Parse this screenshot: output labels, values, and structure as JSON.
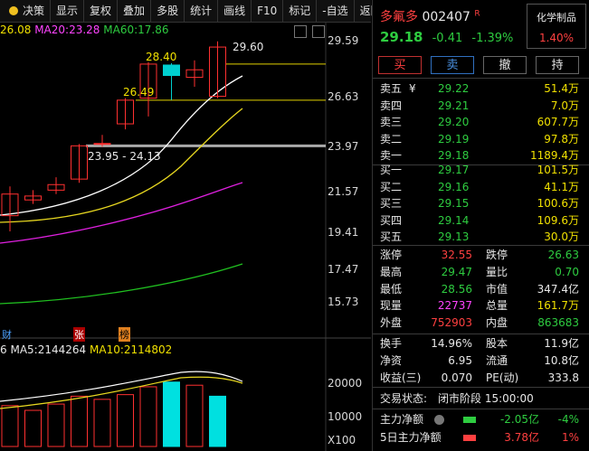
{
  "toolbar": {
    "items": [
      "决策",
      "显示",
      "复权",
      "叠加",
      "多股",
      "统计",
      "画线",
      "F10",
      "标记",
      "-自选",
      "返回"
    ]
  },
  "ma_legend": {
    "ma10": "26.08",
    "ma20_label": "MA20:",
    "ma20": "23.28",
    "ma60_label": "MA60:",
    "ma60": "17.86"
  },
  "y_axis": [
    "29.59",
    "26.63",
    "23.97",
    "21.57",
    "19.41",
    "17.47",
    "15.73"
  ],
  "annotations": {
    "high": "29.60",
    "level1": "28.40",
    "level2": "26.49",
    "range": "23.95 - 24.13"
  },
  "markers": [
    "财",
    "张",
    "榜"
  ],
  "vol_legend": {
    "prefix": "6",
    "ma5_label": "MA5:",
    "ma5": "2144264",
    "ma10_label": "MA10:",
    "ma10": "2114802"
  },
  "vol_axis": [
    "20000",
    "10000"
  ],
  "vol_unit": "X100",
  "stock": {
    "name": "多氟多",
    "code": "002407",
    "tag": "R",
    "sector": "化学制品",
    "sector_change": "1.40%",
    "price": "29.18",
    "change": "-0.41",
    "change_pct": "-1.39%"
  },
  "buttons": {
    "buy": "买",
    "sell": "卖",
    "cancel": "撤",
    "hold": "持"
  },
  "asks": [
    {
      "label": "卖五",
      "price": "29.22",
      "vol": "51.4万"
    },
    {
      "label": "卖四",
      "price": "29.21",
      "vol": "7.0万"
    },
    {
      "label": "卖三",
      "price": "29.20",
      "vol": "607.7万"
    },
    {
      "label": "卖二",
      "price": "29.19",
      "vol": "97.8万"
    },
    {
      "label": "卖一",
      "price": "29.18",
      "vol": "1189.4万"
    }
  ],
  "ask_symbol": "¥",
  "bids": [
    {
      "label": "买一",
      "price": "29.17",
      "vol": "101.5万"
    },
    {
      "label": "买二",
      "price": "29.16",
      "vol": "41.1万"
    },
    {
      "label": "买三",
      "price": "29.15",
      "vol": "100.6万"
    },
    {
      "label": "买四",
      "price": "29.14",
      "vol": "109.6万"
    },
    {
      "label": "买五",
      "price": "29.13",
      "vol": "30.0万"
    }
  ],
  "stats1": [
    {
      "l1": "涨停",
      "v1": "32.55",
      "l2": "跌停",
      "v2": "26.63"
    },
    {
      "l1": "最高",
      "v1": "29.47",
      "l2": "量比",
      "v2": "0.70"
    },
    {
      "l1": "最低",
      "v1": "28.56",
      "l2": "市值",
      "v2": "347.4亿"
    },
    {
      "l1": "现量",
      "v1": "22737",
      "l2": "总量",
      "v2": "161.7万"
    },
    {
      "l1": "外盘",
      "v1": "752903",
      "l2": "内盘",
      "v2": "863683"
    }
  ],
  "stats2": [
    {
      "l1": "换手",
      "v1": "14.96%",
      "l2": "股本",
      "v2": "11.9亿"
    },
    {
      "l1": "净资",
      "v1": "6.95",
      "l2": "流通",
      "v2": "10.8亿"
    },
    {
      "l1": "收益(三)",
      "v1": "0.070",
      "l2": "PE(动)",
      "v2": "333.8"
    }
  ],
  "status": {
    "label": "交易状态:",
    "value": "闭市阶段 15:00:00"
  },
  "flow": [
    {
      "label": "主力净额",
      "value": "-2.05亿",
      "pct": "-4%"
    },
    {
      "label": "5日主力净额",
      "value": "3.78亿",
      "pct": "1%"
    }
  ],
  "chart_data": {
    "type": "candlestick",
    "y_ticks": [
      29.59,
      26.63,
      23.97,
      21.57,
      19.41,
      17.47,
      15.73
    ],
    "candles": [
      {
        "o": 20.3,
        "c": 21.4,
        "h": 21.8,
        "l": 19.5
      },
      {
        "o": 21.1,
        "c": 21.3,
        "h": 21.6,
        "l": 20.9
      },
      {
        "o": 21.6,
        "c": 21.9,
        "h": 22.3,
        "l": 21.4
      },
      {
        "o": 22.2,
        "c": 24.0,
        "h": 24.1,
        "l": 22.0
      },
      {
        "o": 24.13,
        "c": 24.13,
        "h": 24.6,
        "l": 23.95
      },
      {
        "o": 25.2,
        "c": 26.49,
        "h": 26.6,
        "l": 24.9
      },
      {
        "o": 26.6,
        "c": 28.4,
        "h": 28.5,
        "l": 25.6
      },
      {
        "o": 28.35,
        "c": 27.8,
        "h": 28.45,
        "l": 26.5
      },
      {
        "o": 27.7,
        "c": 28.1,
        "h": 28.6,
        "l": 27.2
      },
      {
        "o": 26.7,
        "c": 29.3,
        "h": 29.6,
        "l": 26.6
      }
    ],
    "ma_lines": [
      "MA10",
      "MA20",
      "MA60"
    ],
    "volumes": [
      {
        "v": 13000,
        "up": true
      },
      {
        "v": 11500,
        "up": true
      },
      {
        "v": 13500,
        "up": true
      },
      {
        "v": 16000,
        "up": true
      },
      {
        "v": 15000,
        "up": true
      },
      {
        "v": 16500,
        "up": true
      },
      {
        "v": 19000,
        "up": true
      },
      {
        "v": 20500,
        "up": false
      },
      {
        "v": 19500,
        "up": true
      },
      {
        "v": 16000,
        "up": false
      }
    ]
  }
}
